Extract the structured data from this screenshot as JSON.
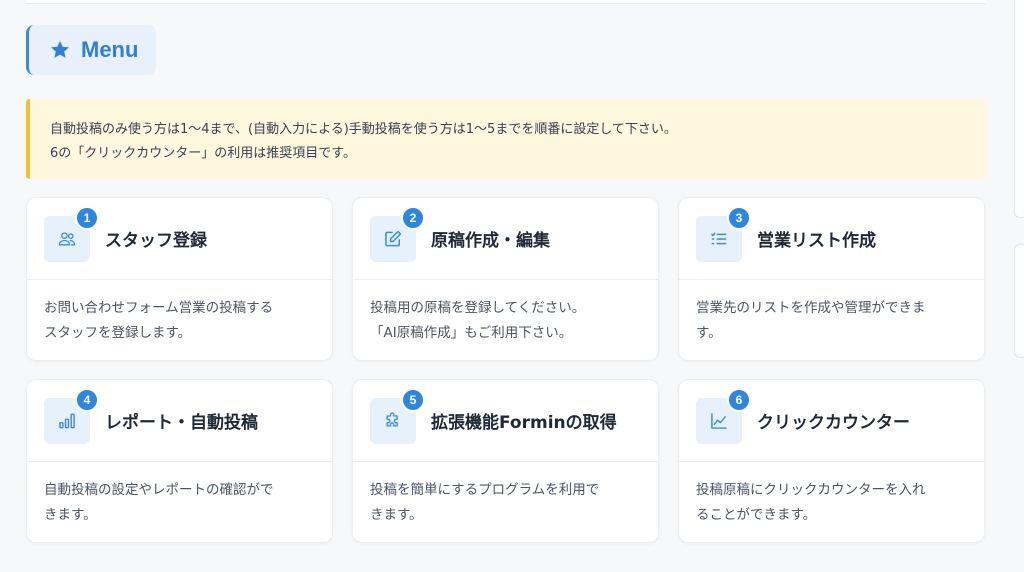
{
  "menu": {
    "label": "Menu",
    "icon": "star-icon",
    "accent": "#2f80d6"
  },
  "notice": {
    "line1": "自動投稿のみ使う方は1〜4まで、(自動入力による)手動投稿を使う方は1〜5までを順番に設定して下さい。",
    "line2": "6の「クリックカウンター」の利用は推奨項目です。",
    "border_color": "#f2c230",
    "bg_color": "#fff8df"
  },
  "cards": [
    {
      "num": "1",
      "title": "スタッフ登録",
      "icon": "users-icon",
      "desc": [
        "お問い合わせフォーム営業の投稿する",
        "スタッフを登録します。"
      ]
    },
    {
      "num": "2",
      "title": "原稿作成・編集",
      "icon": "edit-icon",
      "desc": [
        "投稿用の原稿を登録してください。",
        "「AI原稿作成」もご利用下さい。"
      ]
    },
    {
      "num": "3",
      "title": "営業リスト作成",
      "icon": "list-icon",
      "desc": [
        "営業先のリストを作成や管理ができま",
        "す。"
      ]
    },
    {
      "num": "4",
      "title": "レポート・自動投稿",
      "icon": "bar-chart-icon",
      "desc": [
        "自動投稿の設定やレポートの確認がで",
        "きます。"
      ]
    },
    {
      "num": "5",
      "title": "拡張機能Forminの取得",
      "icon": "puzzle-icon",
      "desc": [
        "投稿を簡単にするプログラムを利用で",
        "きます。"
      ]
    },
    {
      "num": "6",
      "title": "クリックカウンター",
      "icon": "line-chart-icon",
      "desc": [
        "投稿原稿にクリックカウンターを入れ",
        "ることができます。"
      ]
    }
  ],
  "colors": {
    "badge": "#2f86df",
    "icon_bg": "#e6f1fc",
    "icon_stroke": "#3b8be0"
  }
}
